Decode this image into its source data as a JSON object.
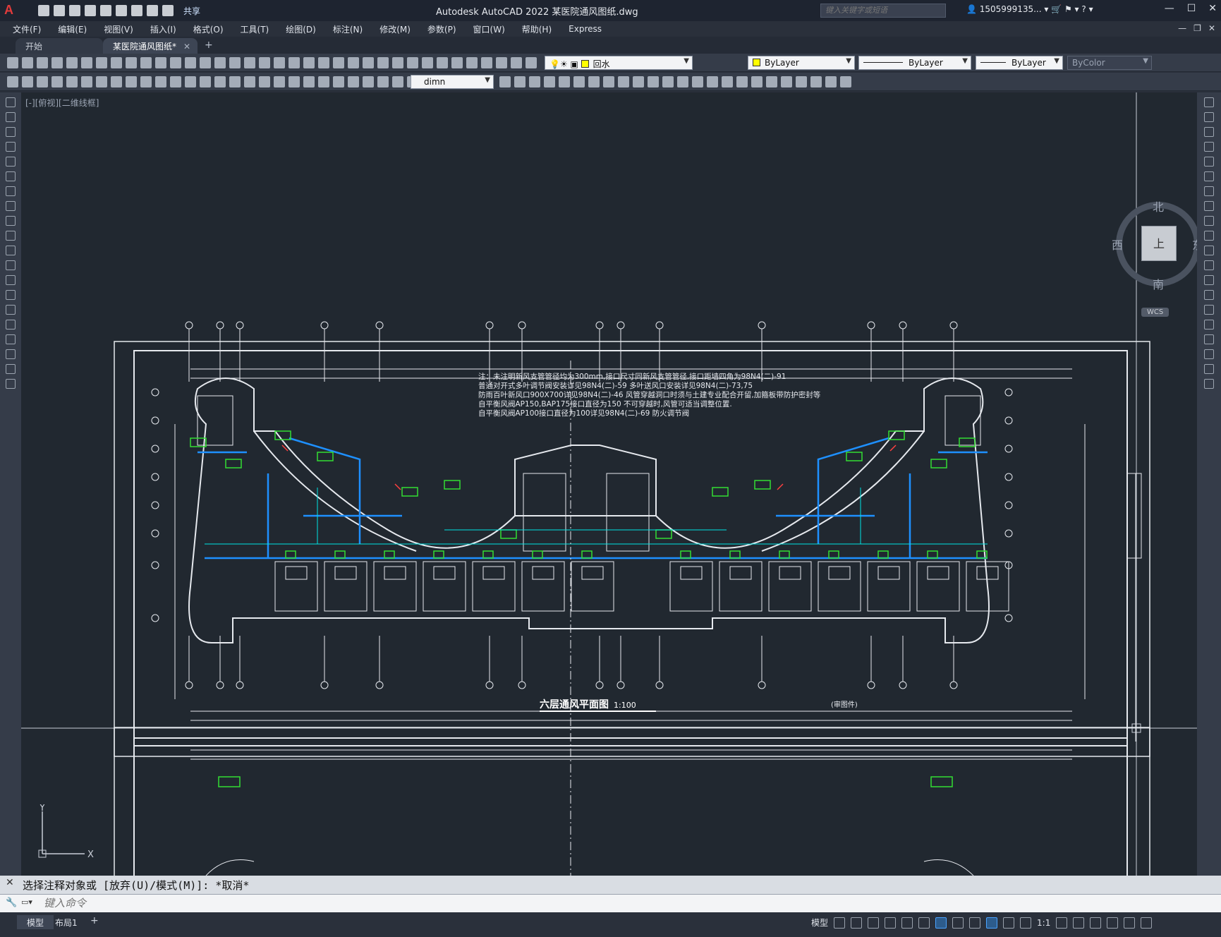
{
  "app": {
    "logo": "A",
    "share_label": "共享",
    "title": "Autodesk AutoCAD 2022    某医院通风图纸.dwg",
    "search_placeholder": "键入关键字或短语",
    "user": "1505999135...",
    "accent_color": "#4aa3ff"
  },
  "menu": [
    "文件(F)",
    "编辑(E)",
    "视图(V)",
    "插入(I)",
    "格式(O)",
    "工具(T)",
    "绘图(D)",
    "标注(N)",
    "修改(M)",
    "参数(P)",
    "窗口(W)",
    "帮助(H)",
    "Express"
  ],
  "tabs": [
    {
      "label": "开始"
    },
    {
      "label": "某医院通风图纸*"
    }
  ],
  "toolbar": {
    "layer": "回水",
    "color": "ByLayer",
    "linetype": "ByLayer",
    "lineweight": "ByLayer",
    "plotstyle": "ByColor",
    "dimstyle": "dimn"
  },
  "viewport": {
    "label": "[-][俯视][二维线框]"
  },
  "viewcube": {
    "north": "北",
    "south": "南",
    "east": "东",
    "west": "西",
    "face": "上",
    "wcs": "WCS"
  },
  "ucs": {
    "x": "X",
    "y": "Y"
  },
  "drawing": {
    "title": "六层通风平面图",
    "scale": "1:100",
    "note_tag": "(审图件)",
    "notes": [
      "注：未注明新风支管管径均为300mm,接口尺寸同新风支管管径,接口距墙四角为98N4(二)-91",
      "普通对开式多叶调节阀安装详见98N4(二)-59      多叶送风口安装详见98N4(二)-73,75",
      "防雨百叶新风口900X700详见98N4(二)-46         风管穿越洞口时须与土建专业配合开留,加箍板带防护密封等",
      "自平衡风阀AP150,BAP175接口直径为150         不可穿越时,风管可适当调整位置.",
      "自平衡风阀AP100接口直径为100详见98N4(二)-69  防火调节阀"
    ]
  },
  "command": {
    "history": "选择注释对象或 [放弃(U)/模式(M)]: *取消*",
    "placeholder": "键入命令"
  },
  "status": {
    "tabs": [
      "模型",
      "布局1"
    ],
    "model_label": "模型",
    "scale": "1:1"
  }
}
